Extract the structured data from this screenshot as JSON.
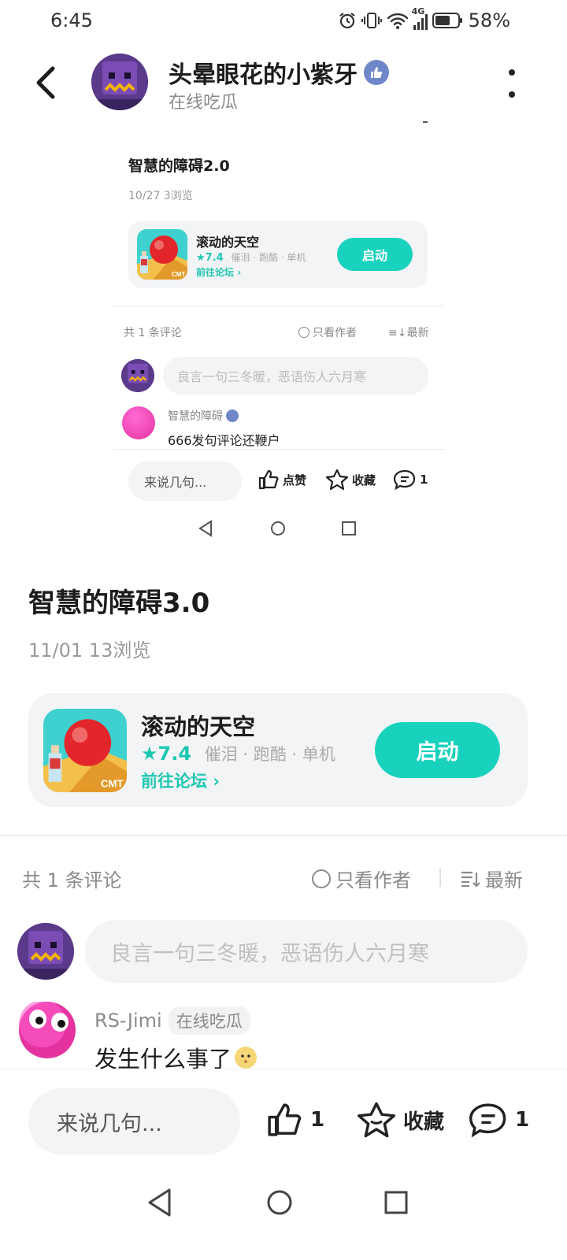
{
  "status_bar": {
    "time": "6:45",
    "network": "4G",
    "battery": "58%"
  },
  "header": {
    "username": "头晕眼花的小紫牙",
    "subtitle": "在线吃瓜"
  },
  "embedded_post": {
    "title": "智慧的障碍2.0",
    "meta": "10/27  3浏览",
    "game": {
      "name": "滚动的天空",
      "rating": "7.4",
      "tags": "催泪 · 跑酷 · 单机",
      "forum_link": "前往论坛",
      "launch_label": "启动"
    },
    "comment_count": "共 1 条评论",
    "author_only": "只看作者",
    "sort": "最新",
    "input_placeholder": "良言一句三冬暖，恶语伤人六月寒",
    "comment": {
      "name": "智慧的障碍",
      "text": "666发句评论还鞭户"
    },
    "say_label": "来说几句...",
    "like_label": "点赞",
    "fav_label": "收藏",
    "reply_count": "1"
  },
  "post": {
    "title": "智慧的障碍3.0",
    "meta": "11/01  13浏览",
    "game": {
      "name": "滚动的天空",
      "rating": "7.4",
      "tags": "催泪 · 跑酷 · 单机",
      "forum_link": "前往论坛",
      "launch_label": "启动"
    }
  },
  "comments_section": {
    "count": "共 1 条评论",
    "author_only": "只看作者",
    "sort": "最新",
    "input_placeholder": "良言一句三冬暖，恶语伤人六月寒",
    "items": [
      {
        "name": "RS-Jimi",
        "tag": "在线吃瓜",
        "text": "发生什么事了"
      }
    ]
  },
  "bottom_bar": {
    "say_label": "来说几句...",
    "like_count": "1",
    "fav_label": "收藏",
    "reply_count": "1"
  },
  "colors": {
    "accent": "#19d2bd",
    "accent_text": "#1ec7b1",
    "card_bg": "#f3f4f6",
    "avatar_purple": "#5b3a8c",
    "avatar_pink": "#e4329f"
  },
  "icons": [
    "alarm-icon",
    "vibrate-icon",
    "wifi-icon",
    "signal-icon",
    "battery-icon",
    "back-arrow-icon",
    "verified-thumb-icon",
    "more-vertical-icon",
    "star-icon",
    "chevron-right-icon",
    "radio-circle-icon",
    "sort-icon",
    "thumb-up-icon",
    "favorite-star-icon",
    "comment-bubble-icon",
    "nav-back-icon",
    "nav-home-icon",
    "nav-recent-icon"
  ]
}
